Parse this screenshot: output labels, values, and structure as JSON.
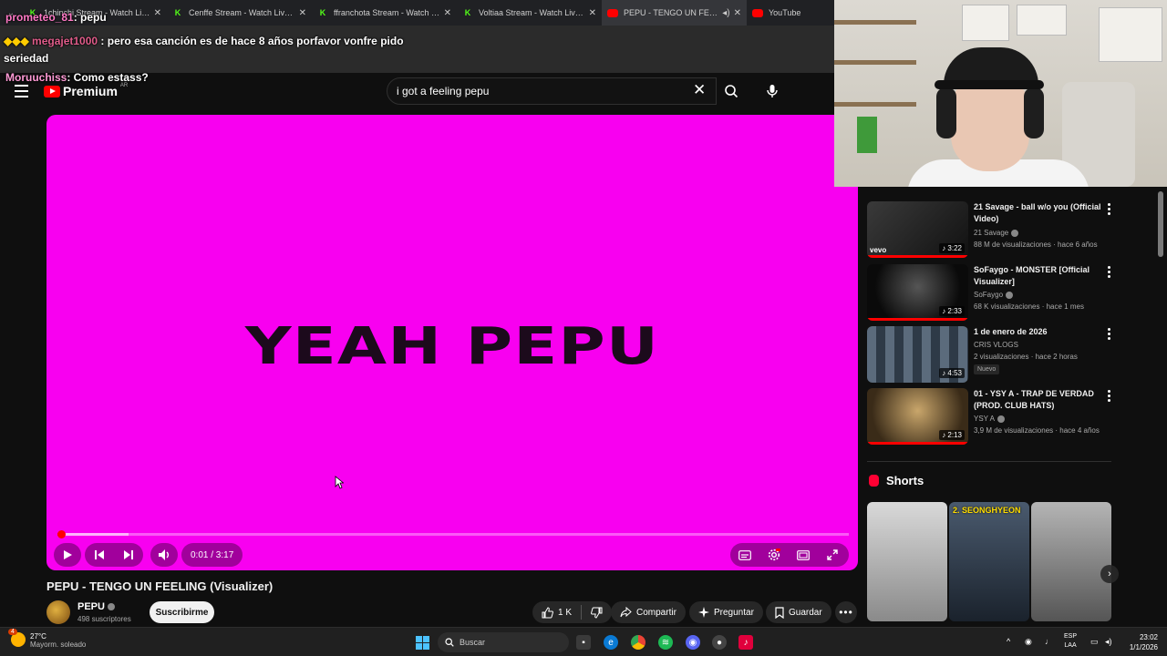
{
  "browser_tabs": [
    {
      "title": "1chinchi Stream - Watch Live on",
      "icon": "kick",
      "active": false
    },
    {
      "title": "Cenffe Stream - Watch Live on",
      "icon": "kick",
      "active": false
    },
    {
      "title": "ffranchota Stream - Watch Live",
      "icon": "kick",
      "active": false
    },
    {
      "title": "Voltiaa Stream - Watch Live on",
      "icon": "kick",
      "active": false
    },
    {
      "title": "PEPU - TENGO UN FEELING",
      "icon": "youtube",
      "active": true
    },
    {
      "title": "YouTube",
      "icon": "youtube",
      "active": false
    }
  ],
  "chat": [
    {
      "user": "prometeo_81",
      "message": ": pepu"
    },
    {
      "user": "megajet1000",
      "message": "pero esa canción es de hace 8 años porfavor vonfre pido seriedad"
    },
    {
      "user": "Moruuchiss",
      "message": ": Como estass?"
    }
  ],
  "header": {
    "logo_text": "Premium",
    "country": "AR",
    "search_value": "i got a feeling pepu"
  },
  "player": {
    "overlay_text": "YEAH PEPU",
    "time_current": "0:01",
    "time_total": "3:17",
    "time_display": "0:01 / 3:17",
    "progress_fraction": 0.005,
    "buffer_fraction": 0.09,
    "background_color": "#f800f0"
  },
  "video": {
    "title": "PEPU - TENGO UN FEELING (Visualizer)",
    "channel": "PEPU",
    "subscribers": "498 suscriptores",
    "subscribe_label": "Suscribirme",
    "like_count": "1 K",
    "share_label": "Compartir",
    "ask_label": "Preguntar",
    "save_label": "Guardar"
  },
  "recommendations": [
    {
      "title": "21 Savage - ball w/o you (Official Video)",
      "channel": "21 Savage",
      "meta": "88 M de visualizaciones · hace 6 años",
      "duration": "3:22",
      "tag": "vevo",
      "thumb": "#2b2b2b",
      "verified": true
    },
    {
      "title": "SoFaygo - MONSTER [Official Visualizer]",
      "channel": "SoFaygo",
      "meta": "68 K visualizaciones · hace 1 mes",
      "duration": "2:33",
      "tag": "",
      "thumb": "#161616",
      "verified": true
    },
    {
      "title": "1 de enero de 2026",
      "channel": "CRIS VLOGS",
      "meta": "2 visualizaciones · hace 2 horas",
      "badge": "Nuevo",
      "duration": "4:53",
      "tag": "",
      "thumb": "#3a4a5a",
      "verified": false
    },
    {
      "title": "01 - YSY A - TRAP DE VERDAD (PROD. CLUB HATS)",
      "channel": "YSY A",
      "meta": "3,9 M de visualizaciones · hace 4 años",
      "duration": "2:13",
      "tag": "",
      "thumb": "#5a4a35",
      "verified": true
    }
  ],
  "shorts": {
    "heading": "Shorts",
    "items": [
      {
        "caption": "",
        "color": "#c8c8c8"
      },
      {
        "caption": "2. SEONGHYEON",
        "color": "#3a4a5c"
      },
      {
        "caption": "",
        "color": "#9a9a9a"
      }
    ]
  },
  "taskbar": {
    "weather_badge": "4",
    "temperature": "27°C",
    "weather_desc": "Mayorm. soleado",
    "search_label": "Buscar",
    "lang_line1": "ESP",
    "lang_line2": "LAA",
    "time": "23:02",
    "date": "1/1/2026"
  },
  "colors": {
    "accent": "#ff0000",
    "kick_green": "#53fc18",
    "chat_user": "#ff79c6"
  }
}
